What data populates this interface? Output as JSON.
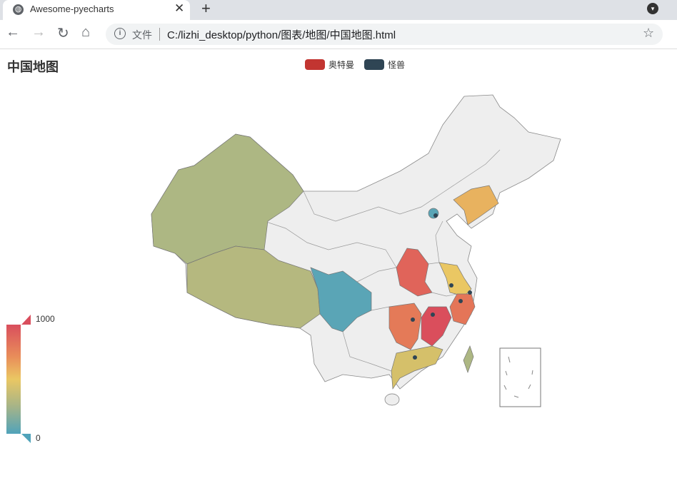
{
  "browser": {
    "tab_title": "Awesome-pyecharts",
    "tab_icon": "globe-icon",
    "address_prefix": "文件",
    "url": "C:/lizhi_desktop/python/图表/地图/中国地图.html"
  },
  "chart_data": {
    "type": "map",
    "title": "中国地图",
    "legend": [
      {
        "name": "奥特曼",
        "color": "#c23531"
      },
      {
        "name": "怪兽",
        "color": "#2f4554"
      }
    ],
    "visual_map": {
      "min": 0,
      "max": 1000,
      "min_label": "0",
      "max_label": "1000",
      "colors": [
        "#50a3ba",
        "#eac763",
        "#d94e5d"
      ]
    },
    "series": [
      {
        "name": "奥特曼",
        "type": "map",
        "data": [
          {
            "region": "新疆",
            "value": 300,
            "color": "#adb783"
          },
          {
            "region": "西藏",
            "value": 350,
            "color": "#b5b87f"
          },
          {
            "region": "四川",
            "value": 80,
            "color": "#5aa5b6"
          },
          {
            "region": "北京",
            "value": 80,
            "color": "#5aa5b6"
          },
          {
            "region": "辽宁",
            "value": 620,
            "color": "#e8b25f"
          },
          {
            "region": "陕西",
            "value": 900,
            "color": "#e0645a"
          },
          {
            "region": "江苏",
            "value": 540,
            "color": "#eac763"
          },
          {
            "region": "浙江",
            "value": 850,
            "color": "#e47558"
          },
          {
            "region": "湖南",
            "value": 830,
            "color": "#e47a58"
          },
          {
            "region": "江西",
            "value": 980,
            "color": "#da4e5c"
          },
          {
            "region": "广东",
            "value": 450,
            "color": "#d5c06a"
          },
          {
            "region": "台湾",
            "value": 300,
            "color": "#adb783"
          }
        ]
      },
      {
        "name": "怪兽",
        "type": "scatter",
        "color": "#2f4554",
        "data": [
          "北京",
          "安徽",
          "江苏",
          "上海",
          "浙江",
          "湖南",
          "江西",
          "广东"
        ]
      }
    ]
  }
}
